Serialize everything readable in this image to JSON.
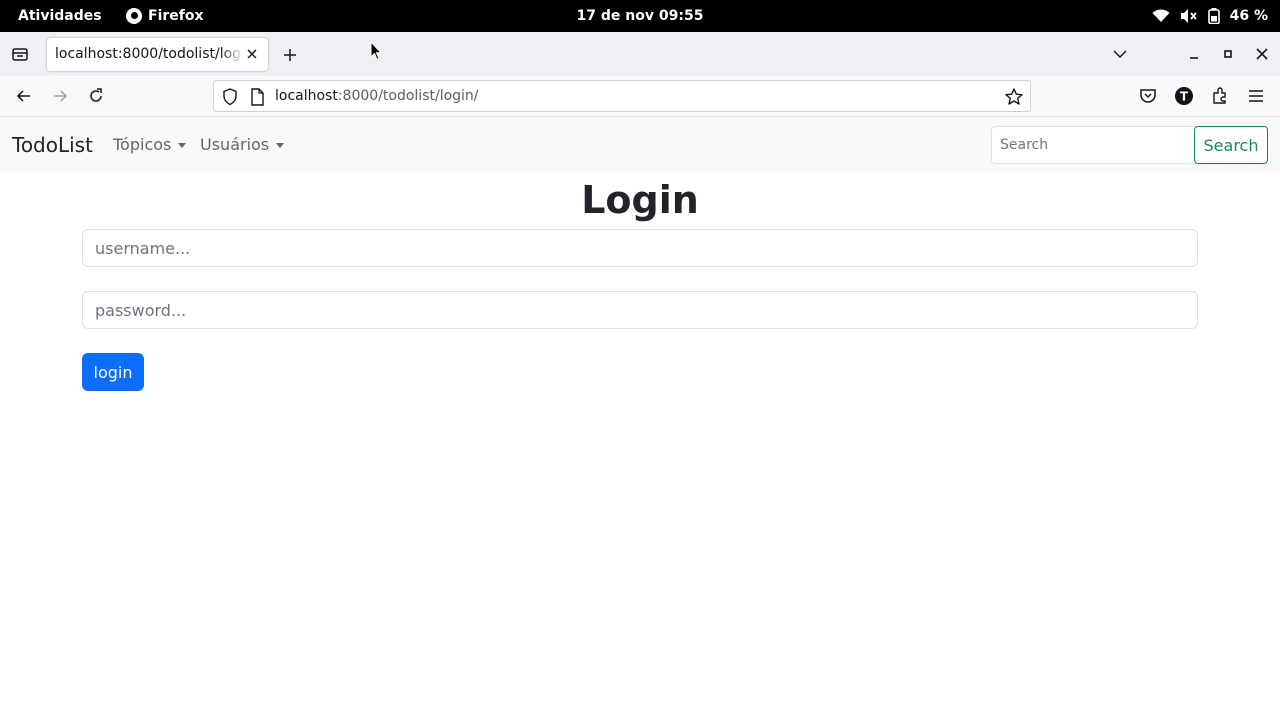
{
  "system": {
    "activities_label": "Atividades",
    "app_name": "Firefox",
    "clock": "17 de nov  09:55",
    "battery": "46 %",
    "icons": [
      "wifi-icon",
      "volume-muted-icon",
      "battery-icon"
    ]
  },
  "browser": {
    "tab_title": "localhost:8000/todolist/login/",
    "url_host": "localhost",
    "url_rest": ":8000/todolist/login/",
    "toolbar_icons": [
      "pocket-icon",
      "account-icon",
      "extensions-icon",
      "menu-icon"
    ]
  },
  "page": {
    "brand": "TodoList",
    "nav": [
      {
        "label": "Tópicos"
      },
      {
        "label": "Usuários"
      }
    ],
    "search": {
      "placeholder": "Search",
      "value": "",
      "button_label": "Search"
    },
    "title": "Login",
    "username": {
      "placeholder": "username...",
      "value": ""
    },
    "password": {
      "placeholder": "password...",
      "value": ""
    },
    "login_button": "login"
  },
  "colors": {
    "primary": "#0d6efd",
    "success": "#198754",
    "navbar_bg": "#f8f9fa"
  }
}
